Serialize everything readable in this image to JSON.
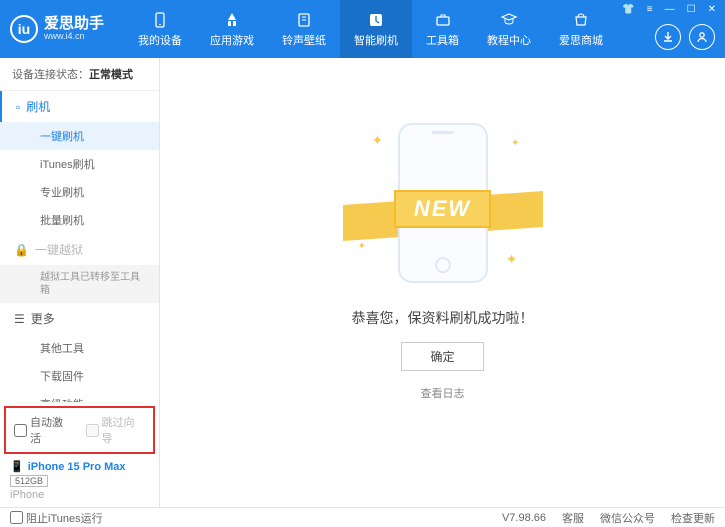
{
  "logo": {
    "mark": "iu",
    "title": "爱思助手",
    "url": "www.i4.cn"
  },
  "nav": [
    {
      "label": "我的设备"
    },
    {
      "label": "应用游戏"
    },
    {
      "label": "铃声壁纸"
    },
    {
      "label": "智能刷机"
    },
    {
      "label": "工具箱"
    },
    {
      "label": "教程中心"
    },
    {
      "label": "爱思商城"
    }
  ],
  "status": {
    "prefix": "设备连接状态：",
    "value": "正常模式"
  },
  "sidebar": {
    "group_flash": "刷机",
    "subs_flash": [
      "一键刷机",
      "iTunes刷机",
      "专业刷机",
      "批量刷机"
    ],
    "group_jb": "一键越狱",
    "jb_note": "越狱工具已转移至工具箱",
    "group_more": "更多",
    "subs_more": [
      "其他工具",
      "下载固件",
      "高级功能"
    ]
  },
  "opts": {
    "auto_activate": "自动激活",
    "skip_guide": "跳过向导"
  },
  "device": {
    "name": "iPhone 15 Pro Max",
    "storage": "512GB",
    "type": "iPhone"
  },
  "main": {
    "ribbon": "NEW",
    "message": "恭喜您，保资料刷机成功啦！",
    "ok": "确定",
    "view_log": "查看日志"
  },
  "footer": {
    "block_itunes": "阻止iTunes运行",
    "version": "V7.98.66",
    "links": [
      "客服",
      "微信公众号",
      "检查更新"
    ]
  }
}
